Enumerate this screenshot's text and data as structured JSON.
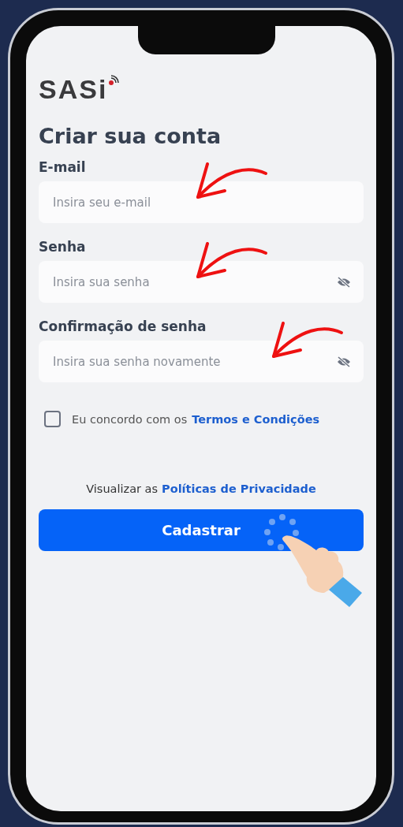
{
  "logo": {
    "text": "SASi"
  },
  "title": "Criar sua conta",
  "fields": [
    {
      "kind": "text",
      "label": "E-mail",
      "placeholder": "Insira seu e-mail"
    },
    {
      "kind": "password",
      "label": "Senha",
      "placeholder": "Insira sua senha"
    },
    {
      "kind": "password",
      "label": "Confirmação de senha",
      "placeholder": "Insira sua senha novamente"
    }
  ],
  "terms": {
    "checked": false,
    "text": "Eu concordo com os",
    "link": "Termos e Condições"
  },
  "privacy": {
    "text": "Visualizar as",
    "link": "Políticas de Privacidade"
  },
  "submit_button": "Cadastrar"
}
